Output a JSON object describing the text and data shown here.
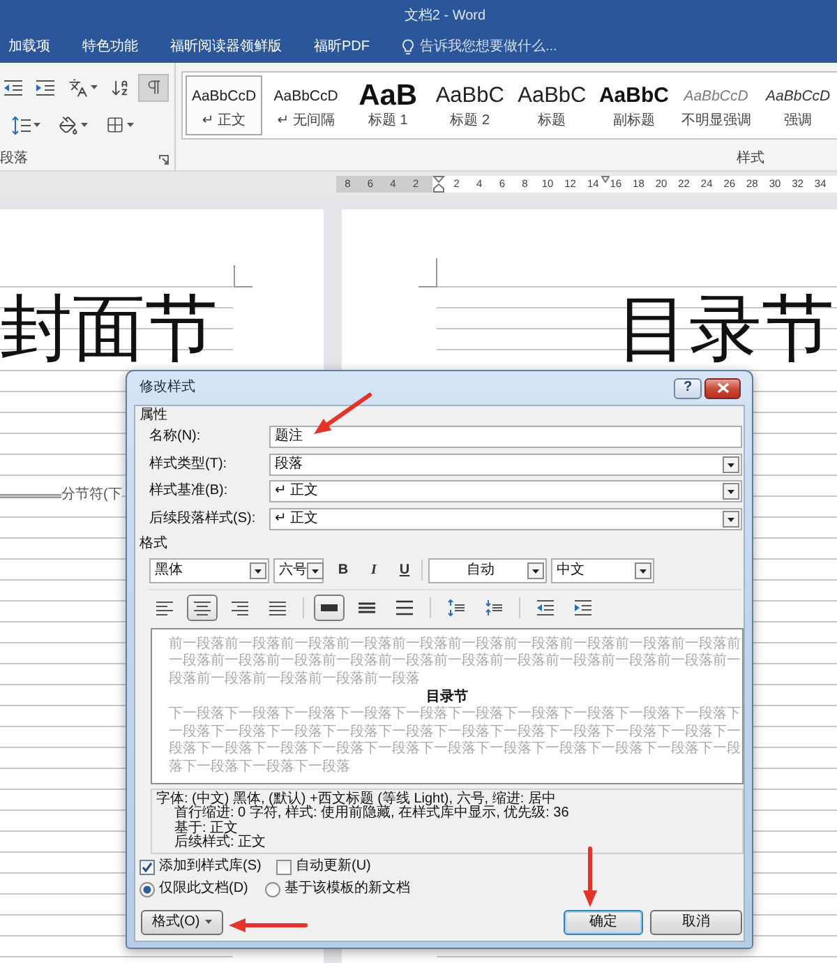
{
  "window": {
    "title": "文档2 - Word"
  },
  "ribbon_tabs": [
    {
      "label": "加载项"
    },
    {
      "label": "特色功能"
    },
    {
      "label": "福昕阅读器领鲜版"
    },
    {
      "label": "福昕PDF"
    }
  ],
  "tell_me": {
    "placeholder": "告诉我您想要做什么..."
  },
  "paragraph_group": {
    "label": "段落",
    "rows": [
      [
        {
          "kind": "outdent",
          "selected": false
        },
        {
          "kind": "indent",
          "selected": false
        },
        {
          "kind": "asian",
          "selected": false
        },
        {
          "kind": "sort",
          "selected": false
        },
        {
          "kind": "marks",
          "selected": true
        }
      ],
      [
        {
          "kind": "spacing",
          "selected": false
        },
        {
          "kind": "shading",
          "selected": false
        },
        {
          "kind": "borders",
          "selected": false
        }
      ]
    ]
  },
  "styles_gallery": {
    "label": "样式",
    "items": [
      {
        "kind": "body",
        "sample": "AaBbCcD",
        "name": "↵ 正文",
        "selected": true
      },
      {
        "kind": "body",
        "sample": "AaBbCcD",
        "name": "↵ 无间隔",
        "selected": false
      },
      {
        "kind": "heading1",
        "sample": "AaB",
        "name": "标题 1",
        "selected": false
      },
      {
        "kind": "heading2",
        "sample": "AaBbC",
        "name": "标题 2",
        "selected": false
      },
      {
        "kind": "title",
        "sample": "AaBbC",
        "name": "标题",
        "selected": false
      },
      {
        "kind": "subtitle",
        "sample": "AaBbC",
        "name": "副标题",
        "selected": false
      },
      {
        "kind": "subtle",
        "sample": "AaBbCcD",
        "name": "不明显强调",
        "selected": false
      },
      {
        "kind": "emphasis",
        "sample": "AaBbCcD",
        "name": "强调",
        "selected": false
      }
    ]
  },
  "ruler": {
    "left_numbers": [
      "8",
      "6",
      "4",
      "2"
    ],
    "right_numbers": [
      "2",
      "4",
      "6",
      "8",
      "10",
      "12",
      "14",
      "16",
      "18",
      "20",
      "22",
      "24",
      "26",
      "28",
      "30",
      "32",
      "34"
    ]
  },
  "pages": [
    {
      "heading": "封面节",
      "section_break": "分节符(下"
    },
    {
      "heading": "目录节"
    }
  ],
  "dialog": {
    "title": "修改样式",
    "help": "?",
    "properties": {
      "label": "属性",
      "fields": [
        {
          "kind": "text",
          "label": "名称(N):",
          "value": "题注"
        },
        {
          "kind": "select",
          "label": "样式类型(T):",
          "value": "段落"
        },
        {
          "kind": "select",
          "label": "样式基准(B):",
          "value": "↵ 正文"
        },
        {
          "kind": "select",
          "label": "后续段落样式(S):",
          "value": "↵ 正文"
        }
      ]
    },
    "format": {
      "label": "格式",
      "font": "黑体",
      "size": "六号",
      "bold": "B",
      "italic": "I",
      "underline": "U",
      "text_colour": "自动",
      "language": "中文",
      "paragraph_tools": [
        {
          "kind": "left",
          "selected": false
        },
        {
          "kind": "center",
          "selected": true
        },
        {
          "kind": "right",
          "selected": false
        },
        {
          "kind": "justify",
          "selected": false
        },
        {
          "kind": "single",
          "selected": true
        },
        {
          "kind": "onehalf",
          "selected": false
        },
        {
          "kind": "double",
          "selected": false
        },
        {
          "kind": "morespace",
          "selected": false
        },
        {
          "kind": "lessspace",
          "selected": false
        },
        {
          "kind": "outdent",
          "selected": false
        },
        {
          "kind": "indent",
          "selected": false
        }
      ]
    },
    "preview": {
      "previous": "前一段落前一段落前一段落前一段落前一段落前一段落前一段落前一段落前一段落前一段落前一段落前一段落前一段落前一段落前一段落前一段落前一段落前一段落前一段落前一段落前一段落前一段落前一段落前一段落前一段落",
      "sample": "目录节",
      "next": "下一段落下一段落下一段落下一段落下一段落下一段落下一段落下一段落下一段落下一段落下一段落下一段落下一段落下一段落下一段落下一段落下一段落下一段落下一段落下一段落下一段落下一段落下一段落下一段落下一段落下一段落下一段落下一段落下一段落下一段落下一段落下一段落下一段落下一段落"
    },
    "description": [
      "字体: (中文) 黑体, (默认) +西文标题 (等线 Light), 六号, 缩进: 居中",
      "首行缩进: 0 字符, 样式: 使用前隐藏, 在样式库中显示, 优先级: 36",
      "基于: 正文",
      "后续样式: 正文"
    ],
    "options": [
      {
        "label": "添加到样式库(S)",
        "checked": true
      },
      {
        "label": "自动更新(U)",
        "checked": false
      }
    ],
    "scope": [
      {
        "label": "仅限此文档(D)",
        "selected": true
      },
      {
        "label": "基于该模板的新文档",
        "selected": false
      }
    ],
    "buttons": [
      {
        "kind": "menu",
        "label": "格式(O)"
      },
      {
        "kind": "default",
        "label": "确定"
      },
      {
        "kind": "plain",
        "label": "取消"
      }
    ]
  }
}
